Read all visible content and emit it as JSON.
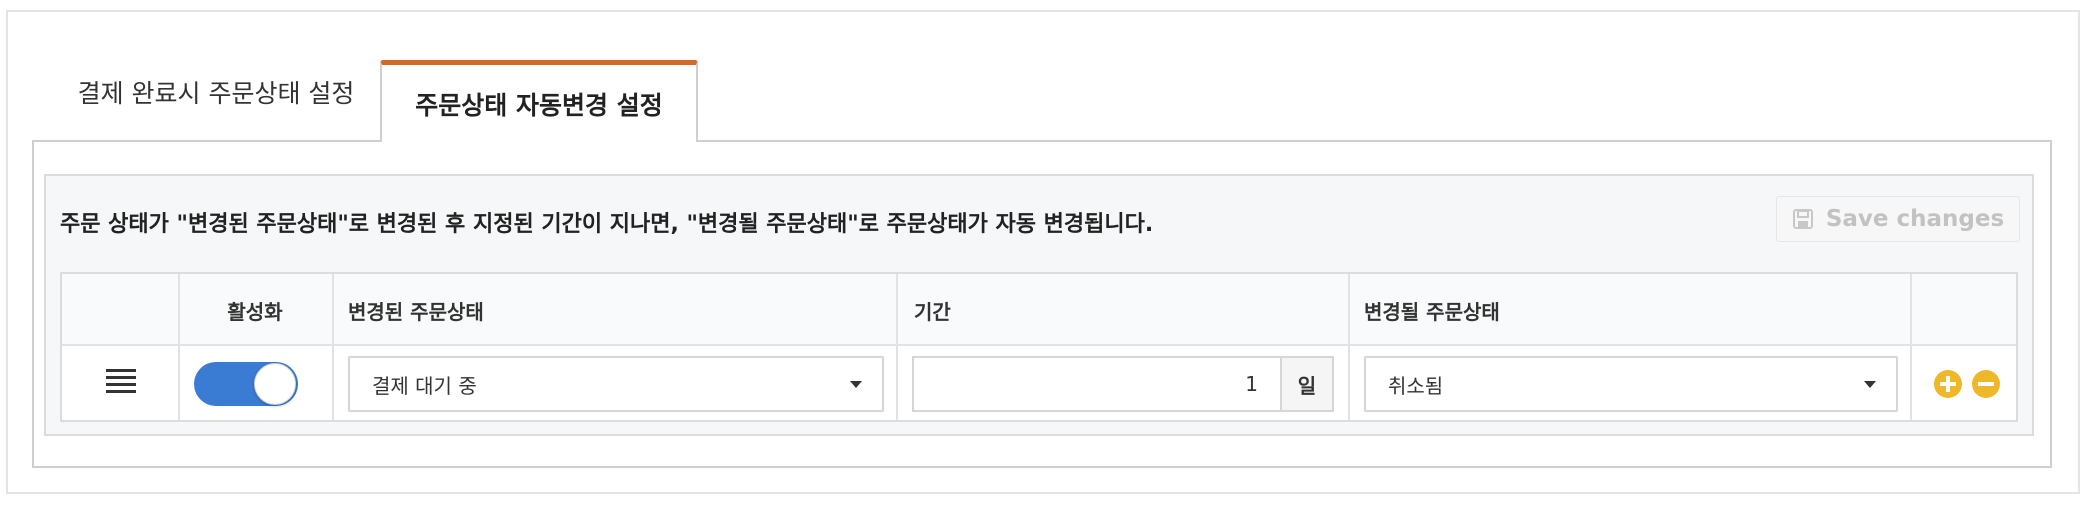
{
  "tabs": [
    {
      "label": "결제 완료시 주문상태 설정",
      "active": false
    },
    {
      "label": "주문상태 자동변경 설정",
      "active": true
    }
  ],
  "description": "주문 상태가 \"변경된 주문상태\"로 변경된 후 지정된 기간이 지나면, \"변경될 주문상태\"로 주문상태가 자동 변경됩니다.",
  "save_button": {
    "label": "Save changes",
    "icon": "floppy-disk-icon",
    "enabled": false
  },
  "table": {
    "headers": {
      "active": "활성화",
      "changed_status": "변경된 주문상태",
      "period": "기간",
      "target_status": "변경될 주문상태"
    },
    "rows": [
      {
        "enabled": true,
        "changed_status": "결제 대기 중",
        "period_value": "1",
        "period_unit": "일",
        "target_status": "취소됨"
      }
    ]
  },
  "colors": {
    "accent_tab": "#d2682a",
    "toggle_on": "#3a7cd4",
    "action_icon": "#efb72a"
  }
}
